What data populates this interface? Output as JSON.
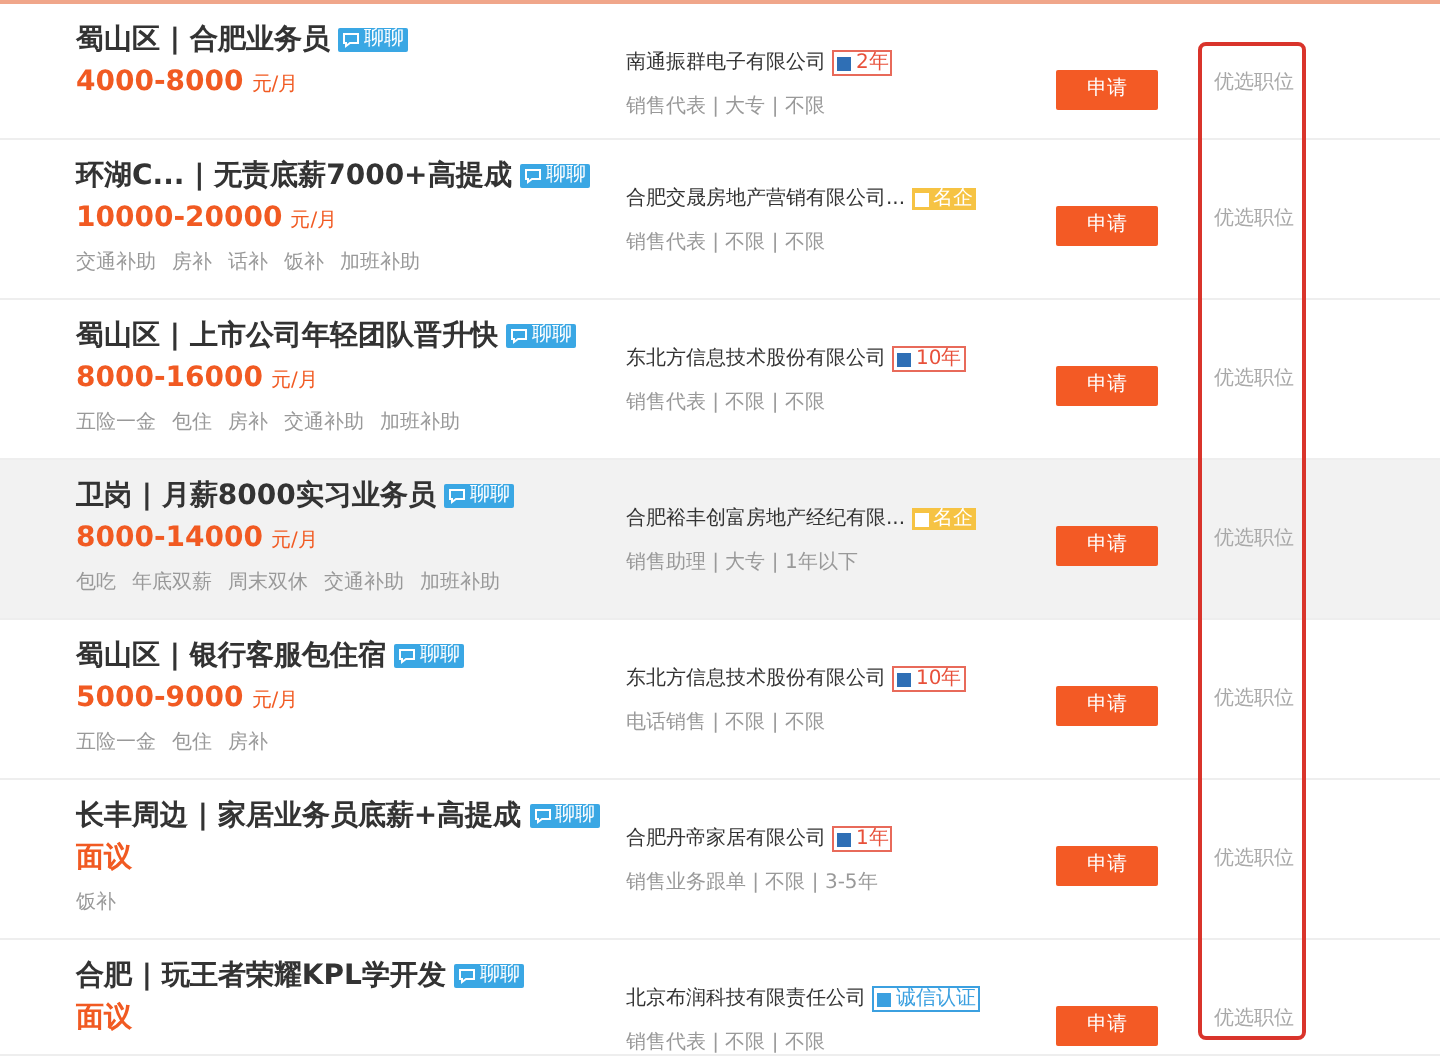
{
  "jobs": [
    {
      "title": "蜀山区 | 合肥业务员",
      "chat_badge": "聊聊",
      "salary": "4000-8000",
      "unit": "元/月",
      "company": "南通振群电子有限公司",
      "company_badge": {
        "kind": "years",
        "text": "2年"
      },
      "requirements": "销售代表 | 大专 | 不限",
      "apply": "申请",
      "pick": "优选职位",
      "highlighted": false
    },
    {
      "title": "环湖C... | 无责底薪7000+高提成",
      "chat_badge": "聊聊",
      "salary": "10000-20000",
      "unit": "元/月",
      "tags": [
        "交通补助",
        "房补",
        "话补",
        "饭补",
        "加班补助"
      ],
      "company": "合肥交晟房地产营销有限公司...",
      "company_badge": {
        "kind": "famous",
        "text": "名企"
      },
      "requirements": "销售代表 | 不限 | 不限",
      "apply": "申请",
      "pick": "优选职位",
      "highlighted": false
    },
    {
      "title": "蜀山区 | 上市公司年轻团队晋升快",
      "chat_badge": "聊聊",
      "salary": "8000-16000",
      "unit": "元/月",
      "tags": [
        "五险一金",
        "包住",
        "房补",
        "交通补助",
        "加班补助"
      ],
      "company": "东北方信息技术股份有限公司",
      "company_badge": {
        "kind": "years",
        "text": "10年"
      },
      "requirements": "销售代表 | 不限 | 不限",
      "apply": "申请",
      "pick": "优选职位",
      "highlighted": false
    },
    {
      "title": "卫岗 | 月薪8000实习业务员",
      "chat_badge": "聊聊",
      "salary": "8000-14000",
      "unit": "元/月",
      "tags": [
        "包吃",
        "年底双薪",
        "周末双休",
        "交通补助",
        "加班补助"
      ],
      "company": "合肥裕丰创富房地产经纪有限...",
      "company_badge": {
        "kind": "famous",
        "text": "名企"
      },
      "requirements": "销售助理 | 大专 | 1年以下",
      "apply": "申请",
      "pick": "优选职位",
      "highlighted": true
    },
    {
      "title": "蜀山区 | 银行客服包住宿",
      "chat_badge": "聊聊",
      "salary": "5000-9000",
      "unit": "元/月",
      "tags": [
        "五险一金",
        "包住",
        "房补"
      ],
      "company": "东北方信息技术股份有限公司",
      "company_badge": {
        "kind": "years",
        "text": "10年"
      },
      "requirements": "电话销售 | 不限 | 不限",
      "apply": "申请",
      "pick": "优选职位",
      "highlighted": false
    },
    {
      "title": "长丰周边 | 家居业务员底薪+高提成",
      "chat_badge": "聊聊",
      "salary": "面议",
      "tags": [
        "饭补"
      ],
      "company": "合肥丹帝家居有限公司",
      "company_badge": {
        "kind": "years",
        "text": "1年"
      },
      "requirements": "销售业务跟单 | 不限 | 3-5年",
      "apply": "申请",
      "pick": "优选职位",
      "highlighted": false
    },
    {
      "title": "合肥 | 玩王者荣耀KPL学开发",
      "chat_badge": "聊聊",
      "salary": "面议",
      "company": "北京布润科技有限责任公司",
      "company_badge": {
        "kind": "verified",
        "text": "诚信认证"
      },
      "requirements": "销售代表 | 不限 | 不限",
      "apply": "申请",
      "pick": "优选职位",
      "highlighted": false
    }
  ]
}
